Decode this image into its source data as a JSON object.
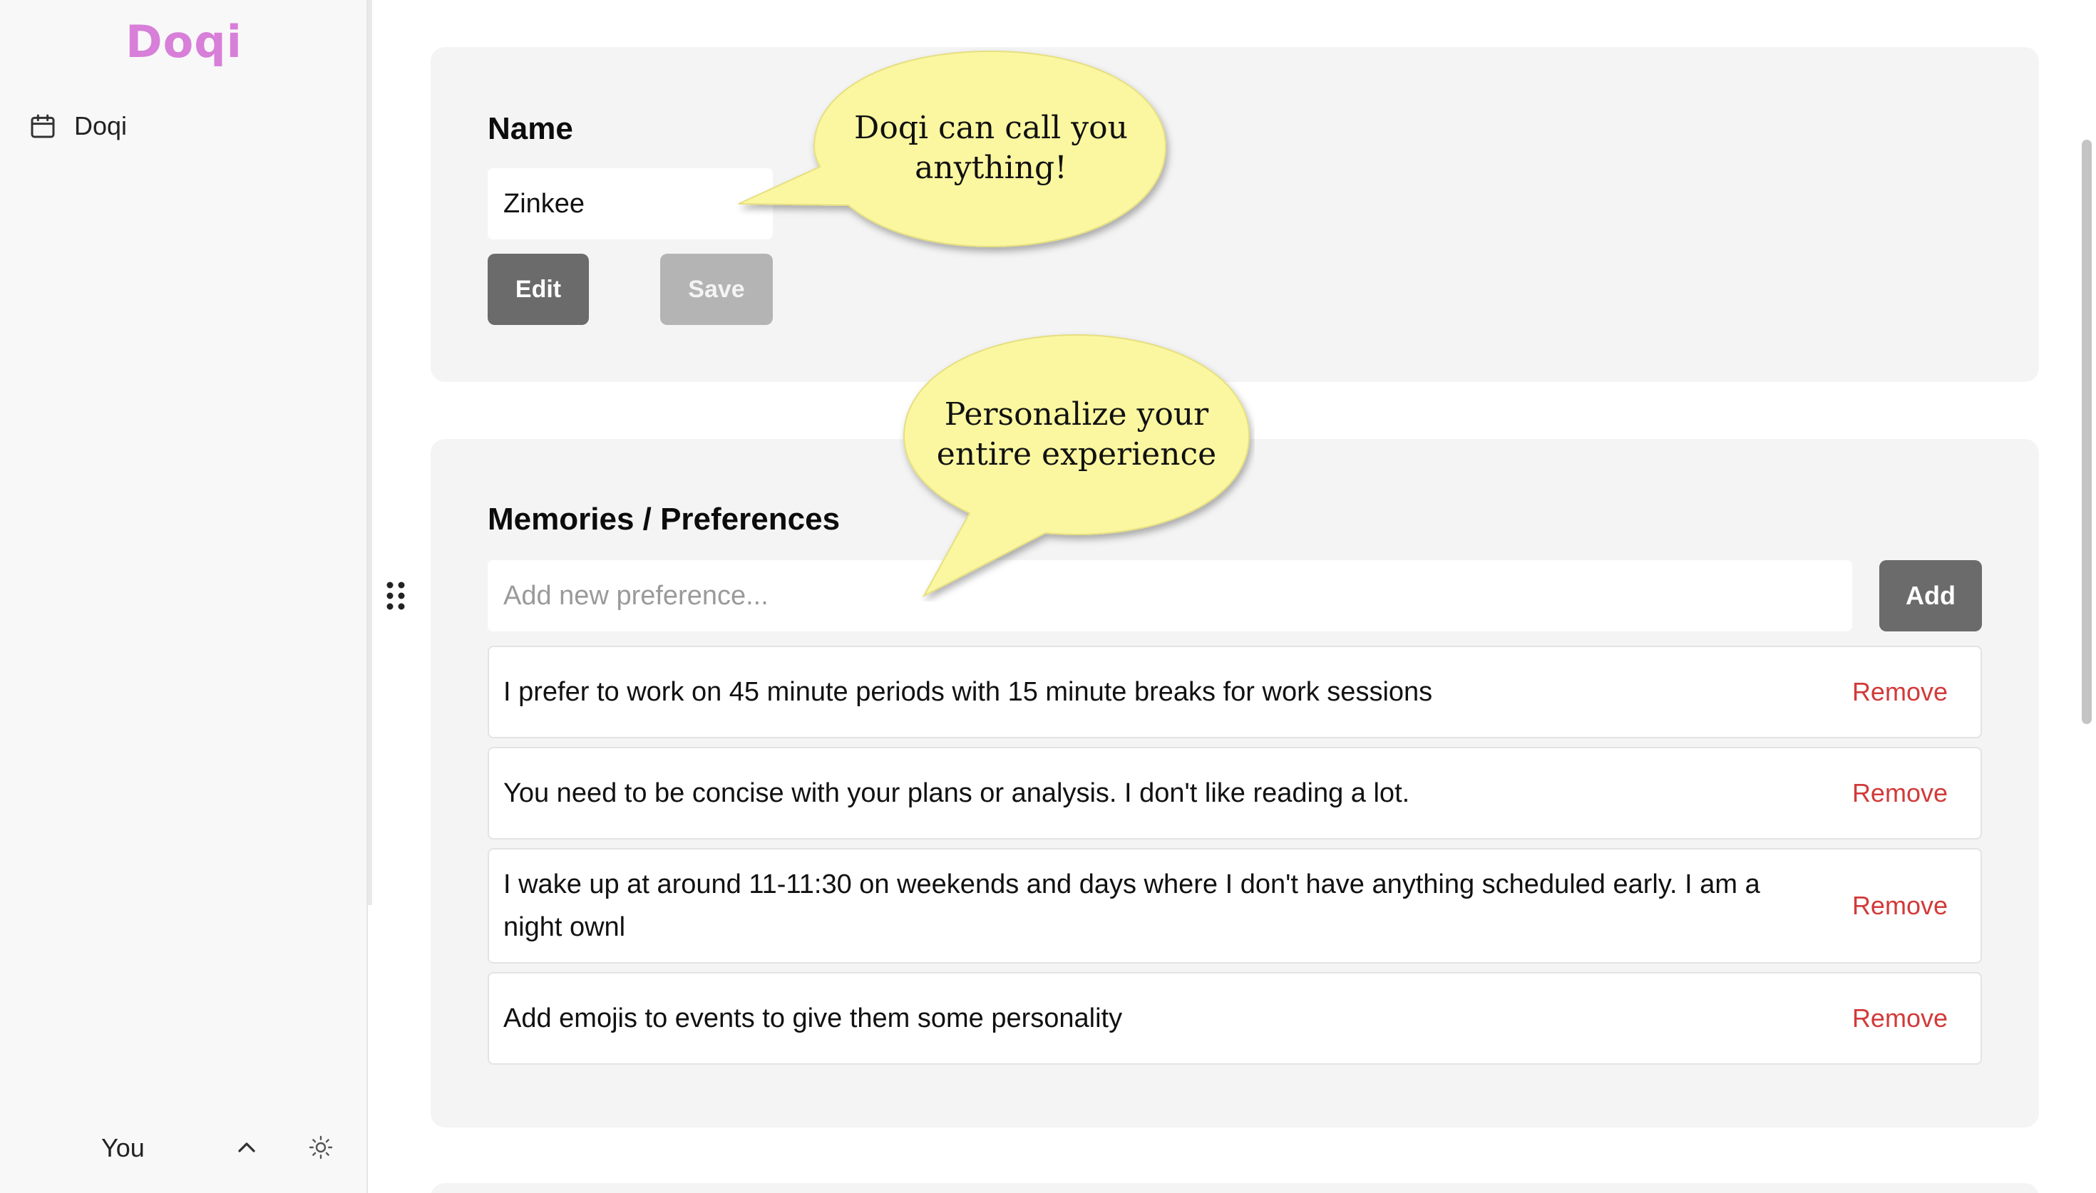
{
  "app": {
    "logo": "Doqi",
    "logo_color": "#d77fd9"
  },
  "sidebar": {
    "items": [
      {
        "label": "Doqi",
        "icon": "calendar-icon"
      }
    ],
    "user": {
      "name": "You",
      "expand_icon": "chevron-up-icon",
      "theme_icon": "sun-icon"
    }
  },
  "name_section": {
    "heading": "Name",
    "value": "Zinkee",
    "edit_label": "Edit",
    "save_label": "Save"
  },
  "memories_section": {
    "heading": "Memories / Preferences",
    "placeholder": "Add new preference...",
    "add_label": "Add",
    "items": [
      {
        "text": "I prefer to work on 45 minute periods with 15 minute breaks for work sessions",
        "action": "Remove"
      },
      {
        "text": "You need to be concise with your plans or analysis. I don't like reading a lot.",
        "action": "Remove"
      },
      {
        "text": "I wake up at around 11-11:30 on weekends and days where I don't have anything scheduled early. I am a night ownl",
        "action": "Remove"
      },
      {
        "text": "Add emojis to events to give them some personality",
        "action": "Remove"
      }
    ]
  },
  "callouts": {
    "name_bubble": [
      "Doqi can call you",
      "anything!"
    ],
    "prefs_bubble": [
      "Personalize your",
      "entire experience"
    ],
    "bubble_color": "#fbf7a0"
  },
  "colors": {
    "dark_button": "#6b6b6b",
    "disabled_button": "#b4b4b4",
    "remove": "#d23a3a"
  }
}
